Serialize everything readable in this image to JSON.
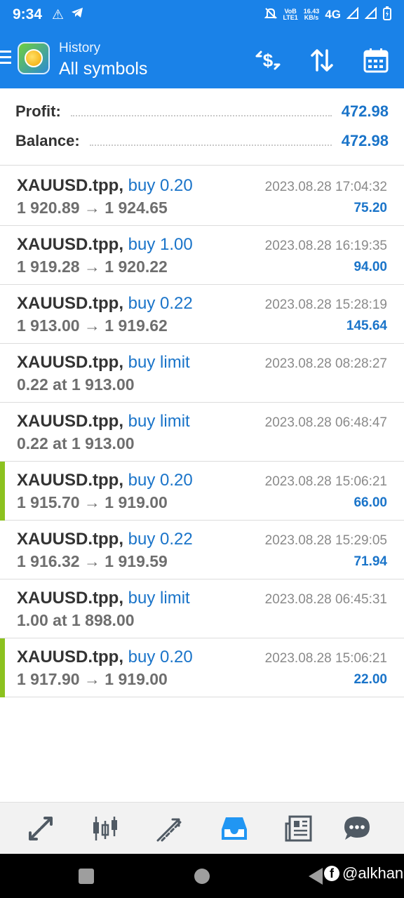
{
  "status_bar": {
    "time": "9:34",
    "net_speed_value": "16.43",
    "net_speed_unit": "KB/s",
    "volte_top": "VoB",
    "volte_bottom": "LTE1",
    "network": "4G",
    "icons": [
      "warning-icon",
      "telegram-icon",
      "mute-icon",
      "signal-icon",
      "signal-icon",
      "battery-charging-icon"
    ]
  },
  "toolbar": {
    "title": "History",
    "subtitle": "All symbols",
    "icons": [
      "menu-icon",
      "app-logo",
      "dollar-exchange-icon",
      "sort-icon",
      "calendar-icon"
    ]
  },
  "summary": {
    "profit_label": "Profit:",
    "profit_value": "472.98",
    "balance_label": "Balance:",
    "balance_value": "472.98"
  },
  "deals": [
    {
      "symbol": "XAUUSD.tpp,",
      "action": "buy 0.20",
      "prices": "1 920.89 → 1 924.65",
      "time": "2023.08.28 17:04:32",
      "profit": "75.20",
      "marked": false
    },
    {
      "symbol": "XAUUSD.tpp,",
      "action": "buy 1.00",
      "prices": "1 919.28 → 1 920.22",
      "time": "2023.08.28 16:19:35",
      "profit": "94.00",
      "marked": false
    },
    {
      "symbol": "XAUUSD.tpp,",
      "action": "buy 0.22",
      "prices": "1 913.00 → 1 919.62",
      "time": "2023.08.28 15:28:19",
      "profit": "145.64",
      "marked": false
    },
    {
      "symbol": "XAUUSD.tpp,",
      "action": "buy limit",
      "prices": "0.22 at 1 913.00",
      "time": "2023.08.28 08:28:27",
      "profit": "",
      "marked": false
    },
    {
      "symbol": "XAUUSD.tpp,",
      "action": "buy limit",
      "prices": "0.22 at 1 913.00",
      "time": "2023.08.28 06:48:47",
      "profit": "",
      "marked": false
    },
    {
      "symbol": "XAUUSD.tpp,",
      "action": "buy 0.20",
      "prices": "1 915.70 → 1 919.00",
      "time": "2023.08.28 15:06:21",
      "profit": "66.00",
      "marked": true
    },
    {
      "symbol": "XAUUSD.tpp,",
      "action": "buy 0.22",
      "prices": "1 916.32 → 1 919.59",
      "time": "2023.08.28 15:29:05",
      "profit": "71.94",
      "marked": false
    },
    {
      "symbol": "XAUUSD.tpp,",
      "action": "buy limit",
      "prices": "1.00 at 1 898.00",
      "time": "2023.08.28 06:45:31",
      "profit": "",
      "marked": false
    },
    {
      "symbol": "XAUUSD.tpp,",
      "action": "buy 0.20",
      "prices": "1 917.90 → 1 919.00",
      "time": "2023.08.28 15:06:21",
      "profit": "22.00",
      "marked": true
    }
  ],
  "bottom_nav": {
    "items": [
      "quotes-icon",
      "chart-icon",
      "trade-icon",
      "history-icon",
      "news-icon",
      "chat-icon"
    ],
    "active_index": 3
  },
  "watermark": {
    "badge": "f",
    "text": "@alkhan"
  },
  "colors": {
    "header_blue": "#1a82e8",
    "value_blue": "#1a74c9",
    "marker_green": "#8cc21f",
    "active_nav": "#2196f3",
    "nav_icon": "#505a64"
  }
}
